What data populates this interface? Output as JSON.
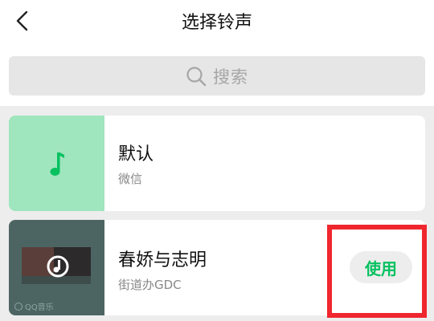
{
  "header": {
    "title": "选择铃声"
  },
  "search": {
    "placeholder": "搜索"
  },
  "ringtones": [
    {
      "name": "默认",
      "source": "微信",
      "icon": "music-note-icon"
    },
    {
      "name": "春娇与志明",
      "source": "街道办GDC",
      "watermark": "QQ音乐",
      "use_label": "使用",
      "icon": "play-badge-icon"
    }
  ],
  "colors": {
    "accent": "#07c160",
    "thumb_green": "#9fe5bd",
    "highlight": "#f0262e"
  }
}
